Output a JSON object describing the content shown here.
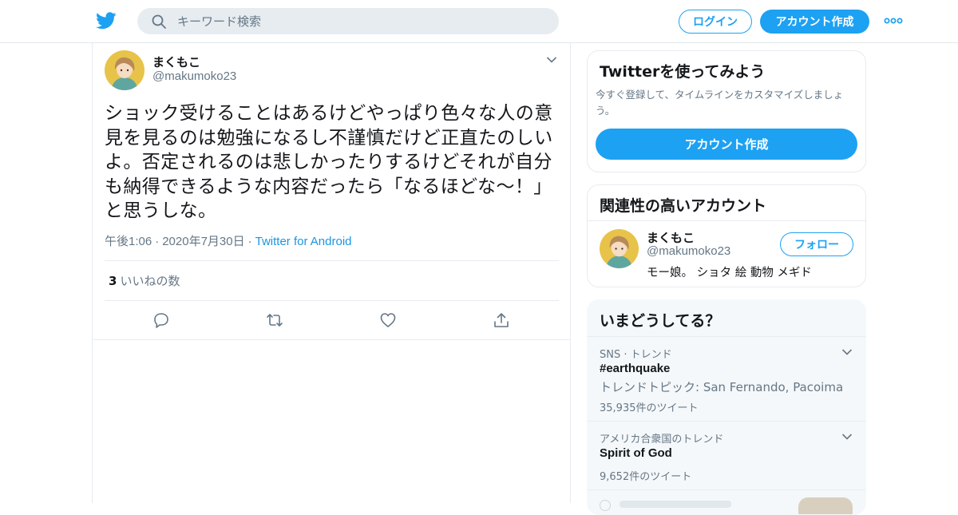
{
  "header": {
    "search_placeholder": "キーワード検索",
    "login_label": "ログイン",
    "signup_label": "アカウント作成"
  },
  "tweet": {
    "author_name": "まくもこ",
    "author_handle": "@makumoko23",
    "text": "ショック受けることはあるけどやっぱり色々な人の意見を見るのは勉強になるし不謹慎だけど正直たのしいよ。否定されるのは悲しかったりするけどそれが自分も納得できるような内容だったら「なるほどな～！」と思うしな。",
    "time": "午後1:06",
    "date": "2020年7月30日",
    "source": "Twitter for Android",
    "likes_count": "3",
    "likes_label": "いいねの数"
  },
  "sidebar": {
    "signup_card": {
      "title": "Twitterを使ってみよう",
      "description": "今すぐ登録して、タイムラインをカスタマイズしましょう。",
      "button_label": "アカウント作成"
    },
    "related": {
      "title": "関連性の高いアカウント",
      "name": "まくもこ",
      "handle": "@makumoko23",
      "bio": "モー娘。 ショタ 絵 動物 メギド",
      "follow_label": "フォロー"
    },
    "trends": {
      "title": "いまどうしてる？",
      "items": [
        {
          "context": "SNS · トレンド",
          "name": "#earthquake",
          "topic": "トレンドトピック: San Fernando, Pacoima",
          "count": "35,935件のツイート"
        },
        {
          "context": "アメリカ合衆国のトレンド",
          "name": "Spirit of God",
          "count": "9,652件のツイート"
        }
      ]
    }
  },
  "colors": {
    "accent": "#1da1f2",
    "secondary_text": "#657786",
    "divider": "#e6ecf0"
  },
  "icons": [
    "twitter-bird-icon",
    "search-icon",
    "more-dots-icon",
    "chevron-down-icon",
    "reply-icon",
    "retweet-icon",
    "like-heart-icon",
    "share-icon"
  ]
}
